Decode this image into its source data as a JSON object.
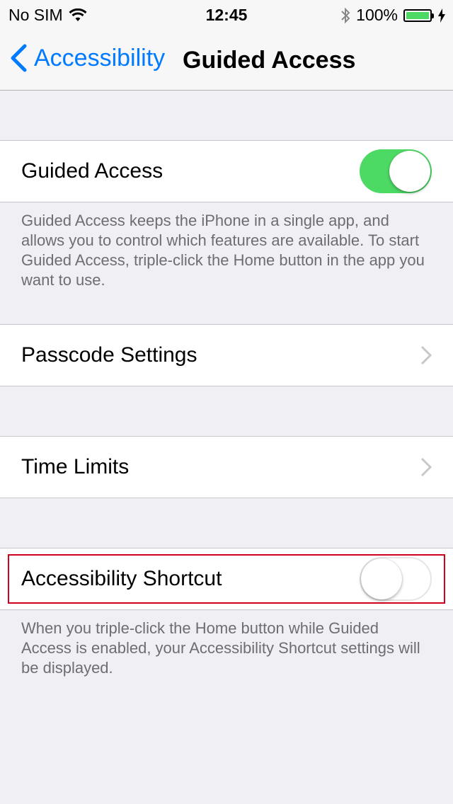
{
  "status_bar": {
    "carrier": "No SIM",
    "time": "12:45",
    "battery_percent": "100%",
    "battery_level": 1.0,
    "icons": [
      "wifi-icon",
      "bluetooth-icon",
      "battery-icon",
      "charging-bolt-icon"
    ]
  },
  "nav": {
    "back_label": "Accessibility",
    "title": "Guided Access"
  },
  "guided_access": {
    "label": "Guided Access",
    "enabled": true,
    "footer": "Guided Access keeps the iPhone in a single app, and allows you to control which features are available. To start Guided Access, triple-click the Home button in the app you want to use."
  },
  "passcode_settings": {
    "label": "Passcode Settings"
  },
  "time_limits": {
    "label": "Time Limits"
  },
  "accessibility_shortcut": {
    "label": "Accessibility Shortcut",
    "enabled": false,
    "footer": "When you triple-click the Home button while Guided Access is enabled, your Accessibility Shortcut settings will be displayed."
  },
  "colors": {
    "accent": "#007aff",
    "switch_on": "#4cd964",
    "highlight": "#d0021b"
  }
}
